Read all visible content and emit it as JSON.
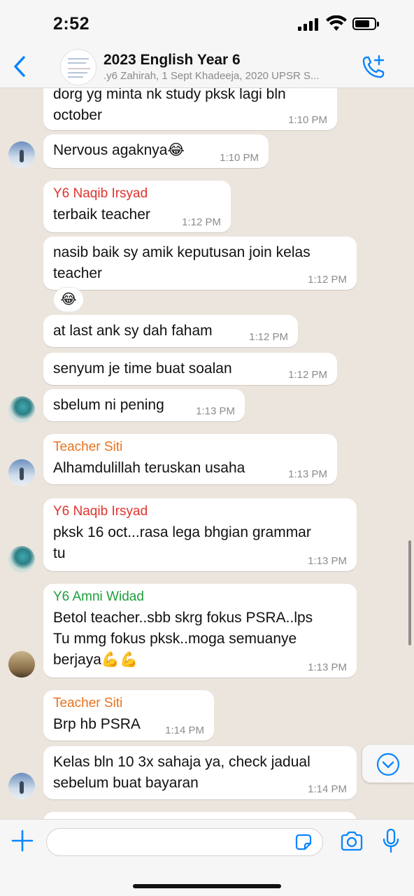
{
  "status_bar": {
    "time": "2:52"
  },
  "header": {
    "title": "2023 English Year 6",
    "subtitle": ".y6 Zahirah, 1 Sept Khadeeja, 2020 UPSR S..."
  },
  "colors": {
    "accent": "#0a84ff",
    "sender_red": "#e0332e",
    "sender_orange": "#e8731e",
    "sender_green": "#1e9e3c",
    "chat_bg": "#ece5dd"
  },
  "messages": [
    {
      "sender": "",
      "text": "dorg yg minta nk study pksk lagi bln\noctober",
      "time": "1:10 PM"
    },
    {
      "sender": "",
      "text": "Nervous agaknya😂",
      "time": "1:10 PM"
    },
    {
      "sender": "Y6 Naqib Irsyad",
      "text": "terbaik teacher",
      "time": "1:12 PM"
    },
    {
      "sender": "",
      "text": "nasib baik sy amik keputusan join kelas\nteacher",
      "time": "1:12 PM"
    },
    {
      "sender": "",
      "text": "at last ank sy dah faham",
      "time": "1:12 PM"
    },
    {
      "sender": "",
      "text": "senyum je time buat soalan",
      "time": "1:12 PM"
    },
    {
      "sender": "",
      "text": "sbelum ni pening",
      "time": "1:13 PM"
    },
    {
      "sender": "Teacher Siti",
      "text": "Alhamdulillah teruskan usaha",
      "time": "1:13 PM"
    },
    {
      "sender": "Y6 Naqib Irsyad",
      "text": "pksk 16 oct...rasa lega bhgian grammar\ntu",
      "time": "1:13 PM"
    },
    {
      "sender": "Y6 Amni Widad",
      "text": "Betol teacher..sbb skrg fokus PSRA..lps\nTu mmg fokus pksk..moga semuanye\nberjaya💪💪",
      "time": "1:13 PM"
    },
    {
      "sender": "Teacher Siti",
      "text": "Brp hb PSRA",
      "time": "1:14 PM"
    },
    {
      "sender": "",
      "text": "Kelas bln 10 3x sahaja ya, check jadual\nsebelum buat bayaran",
      "time": "1:14 PM"
    }
  ],
  "reaction": {
    "emoji": "😂"
  },
  "input": {
    "placeholder": ""
  }
}
